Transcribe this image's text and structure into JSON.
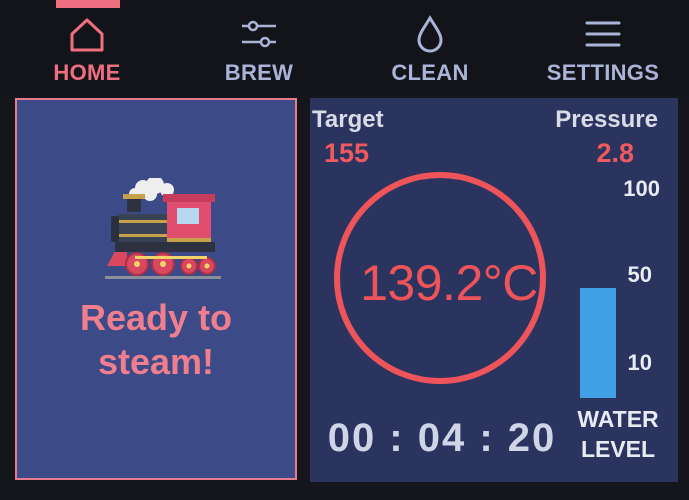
{
  "nav": {
    "items": [
      {
        "label": "HOME",
        "icon": "home-icon",
        "active": true
      },
      {
        "label": "BREW",
        "icon": "sliders-icon",
        "active": false
      },
      {
        "label": "CLEAN",
        "icon": "droplet-icon",
        "active": false
      },
      {
        "label": "SETTINGS",
        "icon": "menu-icon",
        "active": false
      }
    ]
  },
  "status": {
    "icon": "steam-locomotive-icon",
    "line1": "Ready to",
    "line2": "steam!"
  },
  "gauge": {
    "target_label": "Target",
    "target_value": "155",
    "pressure_label": "Pressure",
    "pressure_value": "2.8",
    "temperature": "139.2°C",
    "timer": "00 : 04 : 20",
    "water_scale": [
      "100",
      "50",
      "10"
    ],
    "water_level_label_1": "WATER",
    "water_level_label_2": "LEVEL",
    "water_level_fraction": 0.45
  },
  "colors": {
    "accent": "#ef6f80",
    "nav_inactive": "#aab3d8",
    "status_panel_bg": "#3c4a87",
    "gauge_panel_bg": "#2a345f",
    "temperature": "#ee5459",
    "water": "#3fa0e6"
  }
}
